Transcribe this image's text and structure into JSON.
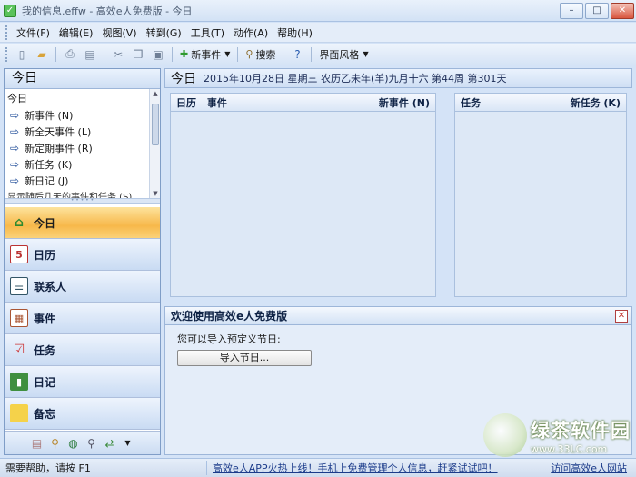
{
  "window": {
    "title": "我的信息.effw - 高效e人免费版 - 今日",
    "minimize": "–",
    "maximize": "□",
    "close": "✕"
  },
  "menu": [
    "文件(F)",
    "编辑(E)",
    "视图(V)",
    "转到(G)",
    "工具(T)",
    "动作(A)",
    "帮助(H)"
  ],
  "toolbar": {
    "new_event": "新事件",
    "search": "搜索",
    "theme": "界面风格"
  },
  "left": {
    "header": "今日",
    "subheader": "今日",
    "quick_actions": [
      "新事件 (N)",
      "新全天事件 (L)",
      "新定期事件 (R)",
      "新任务 (K)",
      "新日记 (J)"
    ],
    "truncated_line": "显示随后几天的事件和任务 (S)"
  },
  "nav": [
    {
      "label": "今日",
      "icon": "home-icon",
      "active": true
    },
    {
      "label": "日历",
      "icon": "calendar-icon",
      "active": false
    },
    {
      "label": "联系人",
      "icon": "contact-card-icon",
      "active": false
    },
    {
      "label": "事件",
      "icon": "event-grid-icon",
      "active": false
    },
    {
      "label": "任务",
      "icon": "checklist-icon",
      "active": false
    },
    {
      "label": "日记",
      "icon": "diary-book-icon",
      "active": false
    },
    {
      "label": "备忘",
      "icon": "sticky-note-icon",
      "active": false
    }
  ],
  "day": {
    "title": "今日",
    "info": "2015年10月28日 星期三 农历乙未年(羊)九月十六 第44周 第301天"
  },
  "events_panel": {
    "col1": "日历",
    "col2": "事件",
    "new_label": "新事件 (N)"
  },
  "tasks_panel": {
    "title": "任务",
    "new_label": "新任务 (K)"
  },
  "welcome": {
    "title": "欢迎使用高效e人免费版",
    "text": "您可以导入预定义节日:",
    "import_button": "导入节日..."
  },
  "status": {
    "left": "需要帮助，请按 F1",
    "middle": "高效e人APP火热上线！手机上免费管理个人信息，赶紧试试吧！",
    "right": "访问高效e人网站"
  },
  "watermark": {
    "title": "绿茶软件园",
    "url": "www.33LC.com"
  },
  "colors": {
    "accent": "#f7b84a",
    "panel_bg": "#d4e3f7",
    "link": "#1b3b8a"
  }
}
